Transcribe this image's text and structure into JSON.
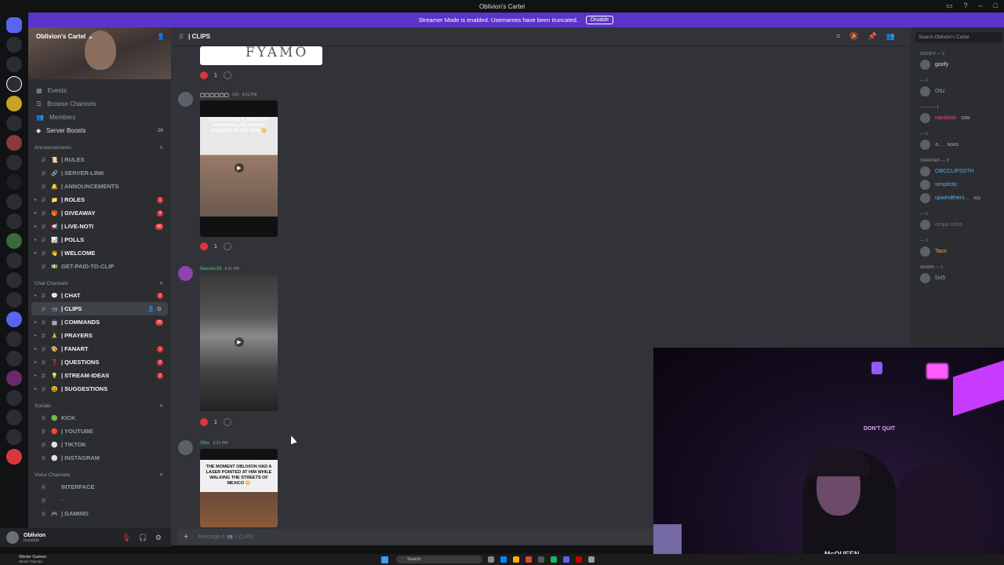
{
  "window": {
    "title": "Oblivion's Cartel"
  },
  "banner": {
    "text": "Streamer Mode is enabled. Usernames have been truncated.",
    "button": "Disable"
  },
  "server": {
    "name": "Oblivion's Cartel",
    "nav": [
      {
        "label": "Events",
        "icon": "calendar-icon"
      },
      {
        "label": "Browse Channels",
        "icon": "browse-icon"
      },
      {
        "label": "Members",
        "icon": "members-icon"
      },
      {
        "label": "Server Boosts",
        "icon": "boost-icon",
        "count": "26"
      }
    ]
  },
  "categories": {
    "announcements": "Announcements",
    "chat": "Chat Channels",
    "socials": "Socials",
    "voice": "Voice Channels"
  },
  "channels": {
    "announcements": [
      {
        "label": "| RULES",
        "emoji": "📜",
        "badge": ""
      },
      {
        "label": "| SERVER-LINK",
        "emoji": "🔗",
        "badge": ""
      },
      {
        "label": "| ANNOUNCEMENTS",
        "emoji": "🔔",
        "badge": ""
      },
      {
        "label": "| ROLES",
        "emoji": "📁",
        "badge": "1",
        "unread": true
      },
      {
        "label": "| GIVEAWAY",
        "emoji": "🎁",
        "badge": "4",
        "unread": true
      },
      {
        "label": "| LIVE-NOTI",
        "emoji": "📢",
        "badge": "60",
        "unread": true
      },
      {
        "label": "| POLLS",
        "emoji": "📊",
        "badge": "",
        "unread": true
      },
      {
        "label": "| WELCOME",
        "emoji": "👋",
        "badge": "",
        "unread": true
      },
      {
        "label": "GET-PAID-TO-CLIP",
        "emoji": "💵",
        "badge": ""
      }
    ],
    "chat": [
      {
        "label": "| CHAT",
        "emoji": "💬",
        "badge": "2",
        "unread": true
      },
      {
        "label": "| CLIPS",
        "emoji": "📹",
        "badge": "",
        "active": true
      },
      {
        "label": "| COMMANDS",
        "emoji": "🤖",
        "badge": "20",
        "unread": true
      },
      {
        "label": "| Prayers",
        "emoji": "🙏",
        "badge": "",
        "unread": true
      },
      {
        "label": "| FANART",
        "emoji": "🎨",
        "badge": "1",
        "unread": true
      },
      {
        "label": "| QUESTIONS",
        "emoji": "❓",
        "badge": "2",
        "unread": true
      },
      {
        "label": "| STREAM-IDEAS",
        "emoji": "💡",
        "badge": "2",
        "unread": true
      },
      {
        "label": "| SUGGESTIONS",
        "emoji": "😃",
        "badge": "",
        "unread": true
      }
    ],
    "socials": [
      {
        "label": "KICK",
        "emoji": "🟢"
      },
      {
        "label": "| YOUTUBE",
        "emoji": "🔴"
      },
      {
        "label": "| TIKTOK",
        "emoji": "⚪"
      },
      {
        "label": "| INSTAGRAM",
        "emoji": "⚪"
      }
    ],
    "voice": [
      {
        "label": "interface",
        "emoji": ""
      },
      {
        "label": "·",
        "emoji": ""
      },
      {
        "label": "| GAMING",
        "emoji": "🎮"
      }
    ]
  },
  "user": {
    "name": "Oblivion",
    "status": "Invisible"
  },
  "channel_header": {
    "title": "| CLIPS",
    "search_placeholder": "Search Oblivion's Cartel"
  },
  "messages": [
    {
      "author": "",
      "time": "",
      "react_count": "1",
      "caption": "",
      "handwriting": "FYAMO"
    },
    {
      "author": "▢▢▢▢▢▢",
      "author_color": "#c9cdd2",
      "tag": "XZz",
      "time": "9:21 PM",
      "react_count": "1",
      "caption": "OBLIVION AND FLAMES PUT ANDY RUIZ LIFE AT RISK SPEEDING IN THE RAIN 😳"
    },
    {
      "author": "Nando19",
      "author_color": "#3ba55d",
      "time": "9:21 PM",
      "react_count": "1",
      "caption": ""
    },
    {
      "author": "Obc",
      "author_color": "#3ba55d",
      "time": "9:21 PM",
      "react_count": "",
      "caption": "THE MOMENT OBLIVION HAD A LASER POINTED AT HIM WHILE WALKING THE STREETS OF MEXICO 😳"
    }
  ],
  "composer": {
    "placeholder": "Message # 📹 | CLIPS"
  },
  "members": {
    "groups": [
      {
        "role": "goofy — 1",
        "members": [
          {
            "name": "goofy",
            "color": "#dbdee1"
          }
        ]
      },
      {
        "role": "— 1",
        "members": [
          {
            "name": "O6z",
            "color": "#949ba4"
          }
        ]
      },
      {
        "role": "— — — 1",
        "members": [
          {
            "name": "nandooo",
            "color": "#eb459e",
            "tag": "SDM"
          }
        ]
      },
      {
        "role": "— 1",
        "members": [
          {
            "name": "a...",
            "color": "#949ba4",
            "tag": "NGRS"
          }
        ]
      },
      {
        "role": "VERIFIED — 3",
        "members": [
          {
            "name": "OBCCLIPSSTH",
            "color": "#5dade2"
          },
          {
            "name": "simplistic",
            "color": "#5dade2"
          },
          {
            "name": "upwindtheni...",
            "color": "#5dade2",
            "tag": "XZz"
          }
        ]
      },
      {
        "role": "— 1",
        "members": [
          {
            "name": "ompa ortos",
            "color": "#6d6f78"
          }
        ]
      },
      {
        "role": "— 1",
        "members": [
          {
            "name": "Taco",
            "color": "#f0b232"
          }
        ]
      },
      {
        "role": "Admin — 1",
        "members": [
          {
            "name": "5ol5",
            "color": "#949ba4"
          }
        ]
      }
    ]
  },
  "webcam": {
    "sign": "DON'T QUIT",
    "shirt": "McQUEEN"
  },
  "taskbar": {
    "weather": "Winter Games",
    "weather_sub": "Winter Olympic",
    "search": "Search"
  },
  "colors": {
    "accent": "#5865f2",
    "banner": "#5a34c9",
    "danger": "#da373c"
  }
}
